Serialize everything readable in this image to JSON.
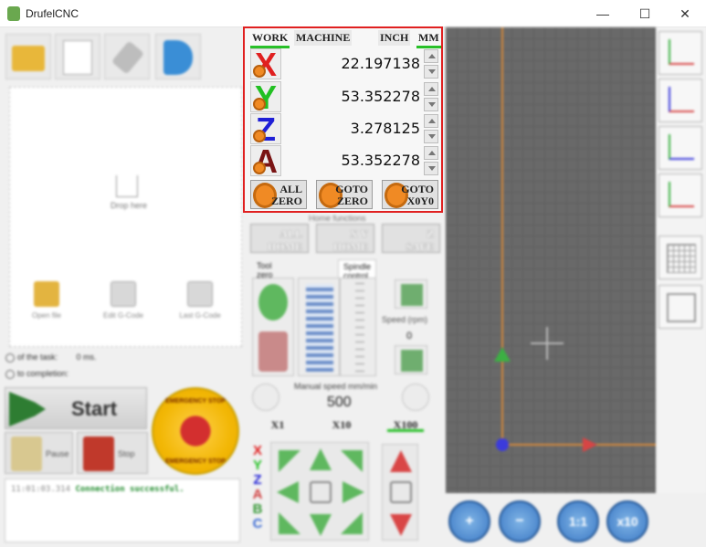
{
  "app": {
    "title": "DrufelCNC"
  },
  "window": {
    "minimize": "—",
    "maximize": "☐",
    "close": "✕"
  },
  "left": {
    "drop_label": "Drop here",
    "open_file": "Open file",
    "edit_gcode": "Edit G-Code",
    "last_gcode": "Last G-Code",
    "task_time_prefix": "of the task:",
    "task_time_value": "0 ms.",
    "completion_prefix": "to completion:",
    "start_label": "Start",
    "pause_label": "Pause",
    "stop_label": "Stop",
    "estop_top": "EMERGENCY STOP",
    "estop_bottom": "EMERGENCY STOP"
  },
  "log": {
    "timestamp": "11:01:03.314",
    "message": "Connection successful."
  },
  "coords": {
    "tabs": {
      "work": "WORK",
      "machine": "MACHINE",
      "inch": "INCH",
      "mm": "MM"
    },
    "axes": [
      {
        "letter": "X",
        "value": "22.197138",
        "color": "#e02020"
      },
      {
        "letter": "Y",
        "value": "53.352278",
        "color": "#22c022"
      },
      {
        "letter": "Z",
        "value": "3.278125",
        "color": "#1f1fd6"
      },
      {
        "letter": "A",
        "value": "53.352278",
        "color": "#7a1414"
      }
    ],
    "buttons": {
      "all_zero_l1": "ALL",
      "all_zero_l2": "ZERO",
      "goto_zero_l1": "GOTO",
      "goto_zero_l2": "ZERO",
      "goto_x0y0_l1": "GOTO",
      "goto_x0y0_l2": "X0Y0"
    }
  },
  "home": {
    "label": "Home functions",
    "all_home_l1": "ALL",
    "all_home_l2": "HOME",
    "xy_home_l1": "X Y",
    "xy_home_l2": "HOME",
    "z_safe_l1": "Z",
    "z_safe_l2": "SAFE"
  },
  "tools": {
    "tab_tool_zero": "Tool zero",
    "tab_spindle": "Spindle control",
    "speed_label": "Speed (rpm)",
    "speed_value": "0"
  },
  "feed": {
    "label": "Manual speed mm/min",
    "value": "500",
    "steps": [
      "X1",
      "X10",
      "X100"
    ]
  },
  "jog": {
    "axes": [
      "X",
      "Y",
      "Z",
      "A",
      "B",
      "C"
    ]
  },
  "zoom": {
    "zoom_in": "+",
    "zoom_out": "−",
    "one_to_one": "1:1",
    "ten_x": "x10"
  }
}
